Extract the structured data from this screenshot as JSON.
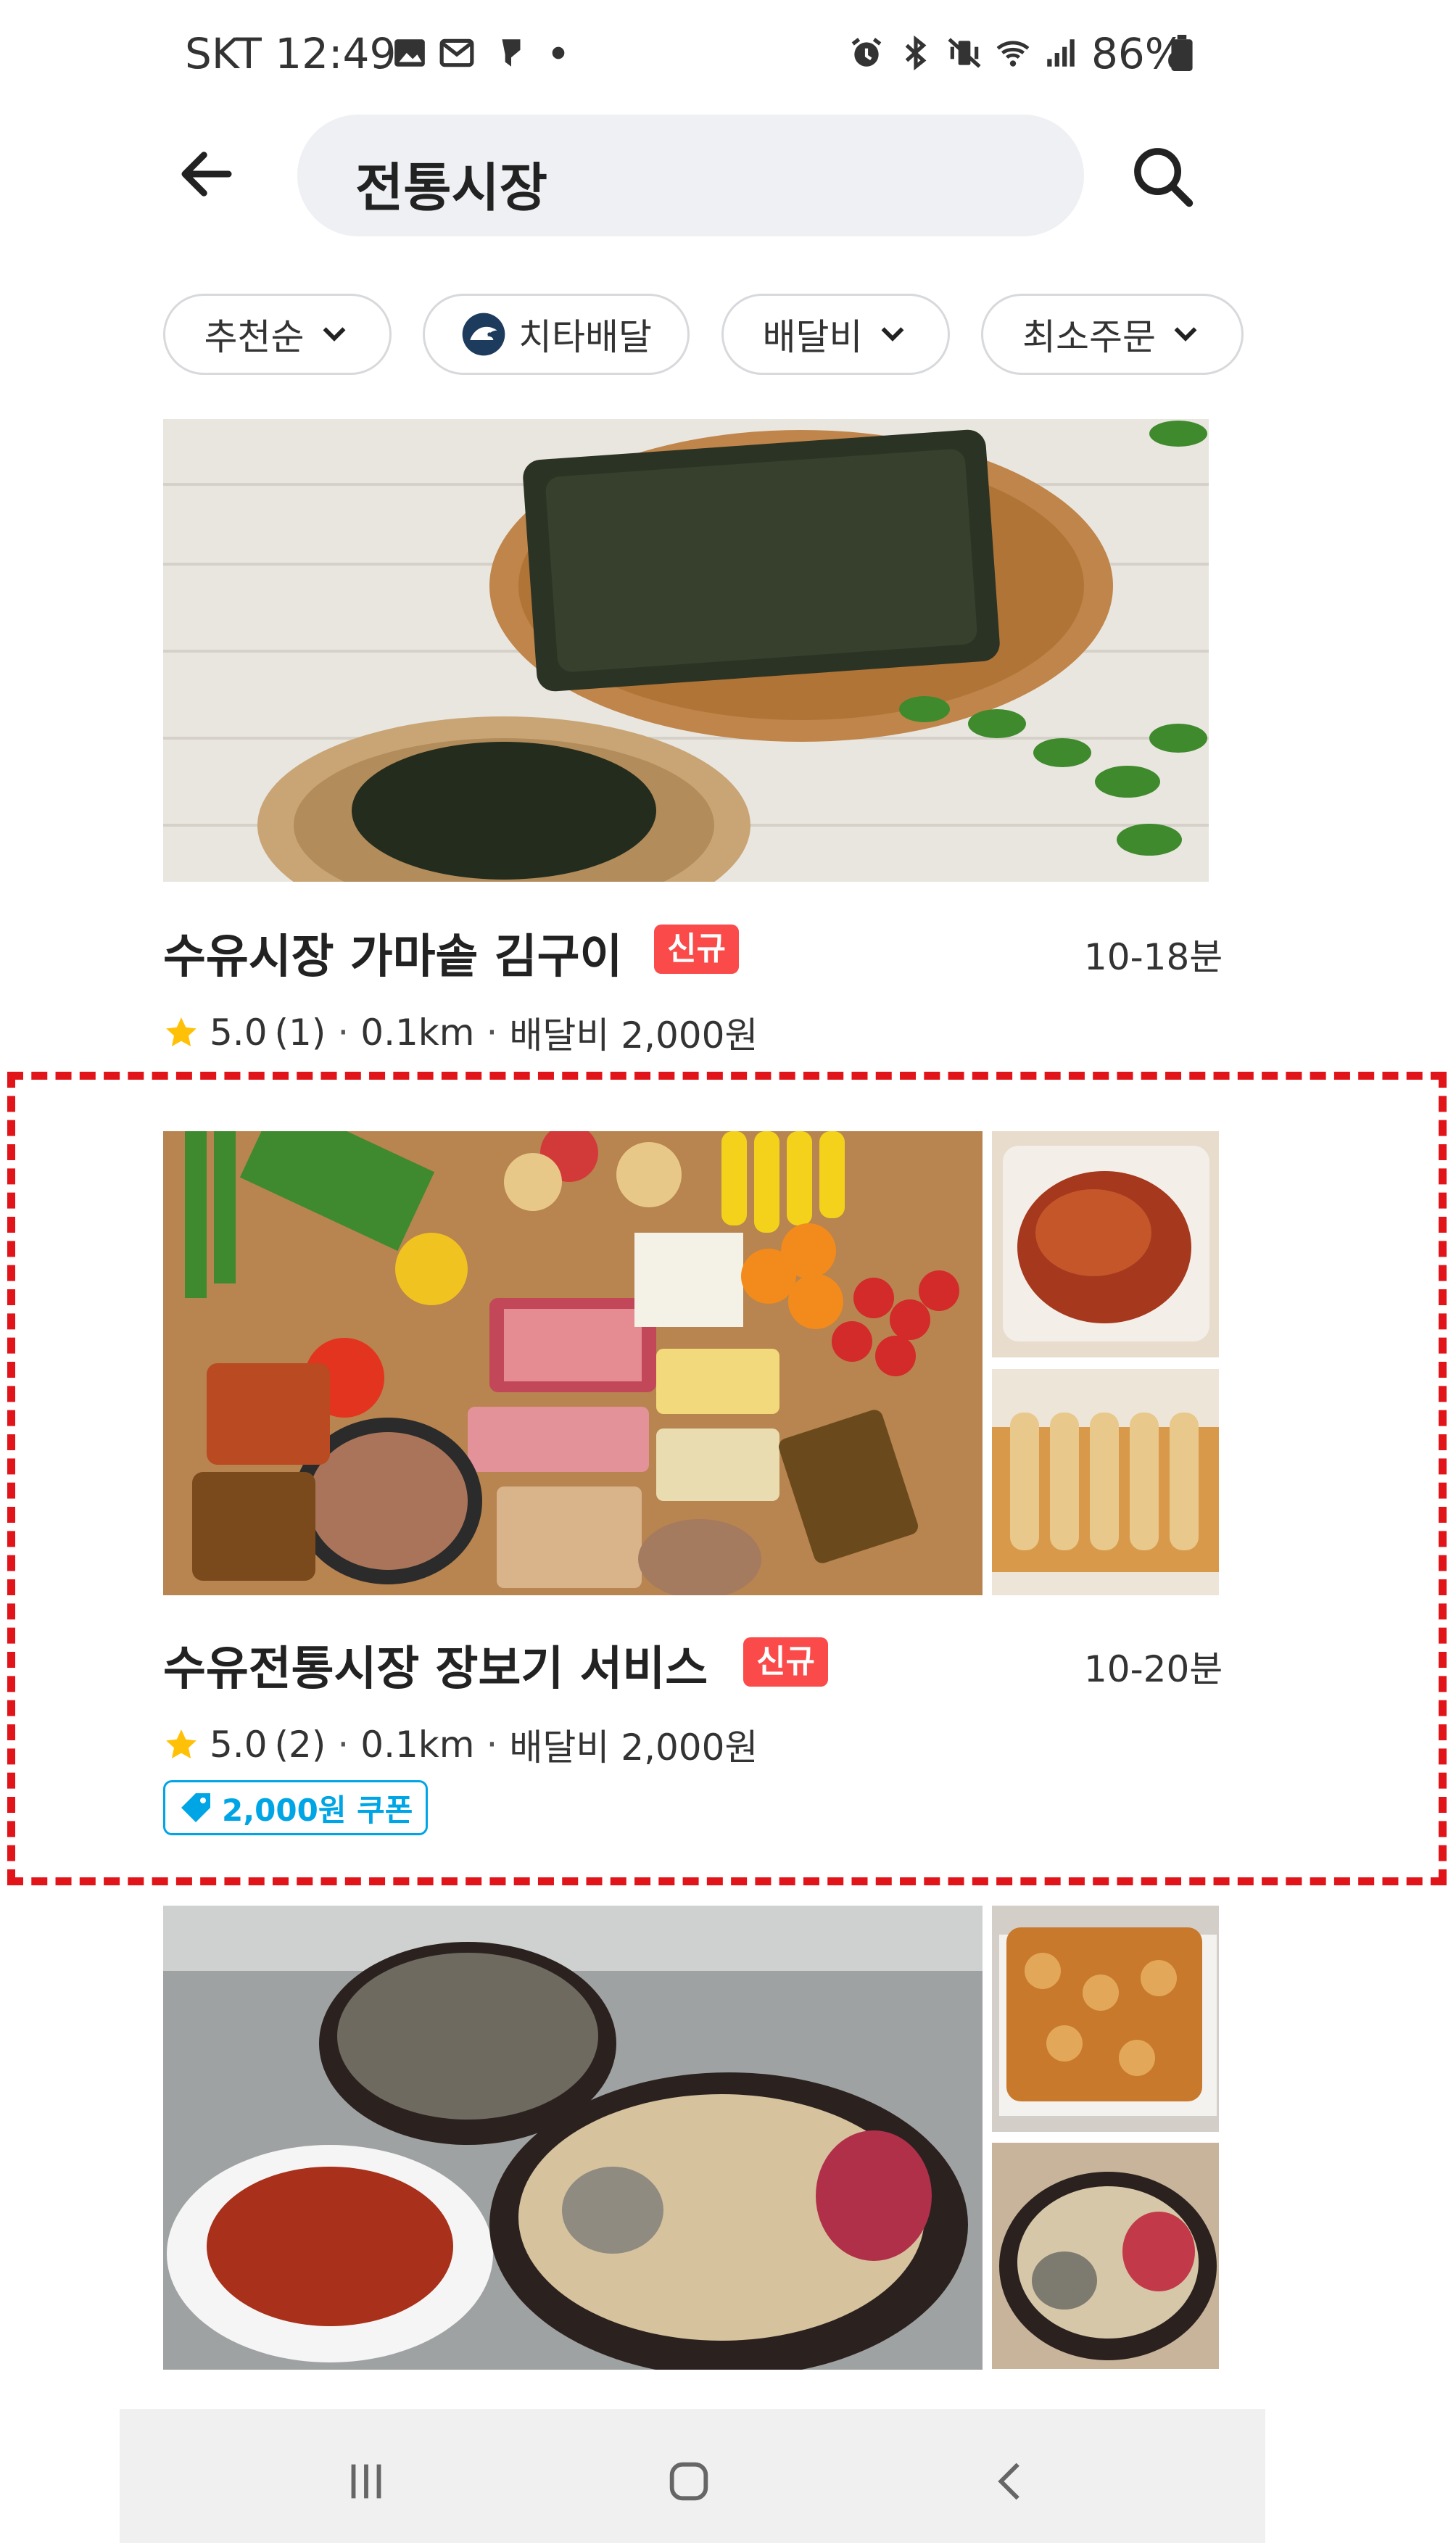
{
  "status_bar": {
    "carrier_time": "SKT 12:49",
    "left_icons": [
      "image-icon",
      "mail-icon",
      "notification-icon",
      "dot-icon"
    ],
    "right_icons": [
      "alarm-icon",
      "bluetooth-icon",
      "vibrate-icon",
      "wifi-icon",
      "signal-icon"
    ],
    "battery": "86%"
  },
  "search": {
    "query": "전통시장"
  },
  "filters": [
    {
      "label": "추천순",
      "icon": "chevron-down-icon"
    },
    {
      "label": "치타배달",
      "icon": "cheetah-icon"
    },
    {
      "label": "배달비",
      "icon": "chevron-down-icon"
    },
    {
      "label": "최소주문",
      "icon": "chevron-down-icon"
    }
  ],
  "stores": [
    {
      "name": "수유시장 가마솥 김구이",
      "badge": "신규",
      "eta": "10-18분",
      "rating": "5.0",
      "reviews": "(1)",
      "distance": "0.1km",
      "delivery_fee": "배달비 2,000원"
    },
    {
      "name": "수유전통시장 장보기 서비스",
      "badge": "신규",
      "eta": "10-20분",
      "rating": "5.0",
      "reviews": "(2)",
      "distance": "0.1km",
      "delivery_fee": "배달비 2,000원",
      "coupon": "2,000원 쿠폰"
    }
  ],
  "colors": {
    "accent": "#00a5e5",
    "badge": "#fa4a4a",
    "highlight": "#e1141a",
    "star": "#ffc107"
  },
  "nav_bar": [
    "recent-apps-icon",
    "home-icon",
    "back-icon"
  ]
}
